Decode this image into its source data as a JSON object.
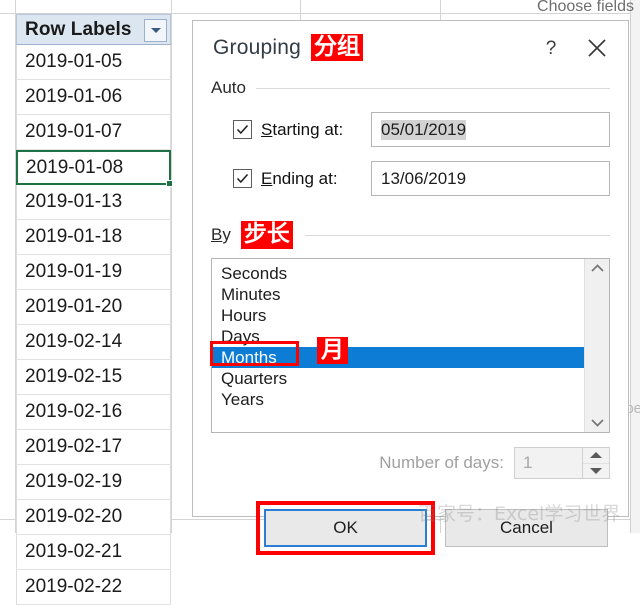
{
  "sheet": {
    "header": {
      "label": "Row Labels",
      "filter_icon": "chevron-down-icon"
    },
    "rows": [
      "2019-01-05",
      "2019-01-06",
      "2019-01-07",
      "2019-01-08",
      "2019-01-13",
      "2019-01-18",
      "2019-01-19",
      "2019-01-20",
      "2019-02-14",
      "2019-02-15",
      "2019-02-16",
      "2019-02-17",
      "2019-02-19",
      "2019-02-20",
      "2019-02-21",
      "2019-02-22"
    ],
    "active_row_index": 3,
    "pivot_pane_title": "Choose fields",
    "side_fragment": "be"
  },
  "dialog": {
    "title": "Grouping",
    "title_annotation": "分组",
    "help_icon": "question-mark-icon",
    "close_icon": "close-icon",
    "auto": {
      "legend": "Auto",
      "starting": {
        "label": "Starting at:",
        "checked": true,
        "value": "05/01/2019"
      },
      "ending": {
        "label": "Ending at:",
        "checked": true,
        "value": "13/06/2019"
      }
    },
    "by": {
      "label": "By",
      "annotation": "步长",
      "options": [
        "Seconds",
        "Minutes",
        "Hours",
        "Days",
        "Months",
        "Quarters",
        "Years"
      ],
      "selected": "Months",
      "selected_annotation": "月",
      "scroll_up_icon": "chevron-up-icon",
      "scroll_down_icon": "chevron-down-icon"
    },
    "number_of_days": {
      "label": "Number of days:",
      "value": "1",
      "enabled": false,
      "up_icon": "spinner-up-icon",
      "down_icon": "spinner-down-icon"
    },
    "buttons": {
      "ok": "OK",
      "cancel": "Cancel",
      "default_focus": "OK"
    }
  },
  "watermark": "百家号：Excel学习世界",
  "colors": {
    "selection_blue": "#0c7cd5",
    "annotation_red": "#ff0000",
    "excel_active_green": "#1e7145",
    "header_fill": "#dce6f1",
    "focus_border_blue": "#2a7fd4"
  }
}
